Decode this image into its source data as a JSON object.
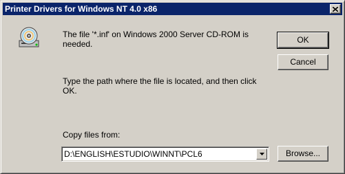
{
  "window": {
    "title": "Printer Drivers for Windows NT 4.0 x86"
  },
  "message": {
    "line1": "The file '*.inf' on Windows 2000 Server CD-ROM is needed.",
    "line2": "Type the path where the file is located, and then click OK."
  },
  "buttons": {
    "ok": "OK",
    "cancel": "Cancel",
    "browse": "Browse..."
  },
  "copy_from": {
    "label": "Copy files from:",
    "value": "D:\\ENGLISH\\ESTUDIO\\WINNT\\PCL6"
  },
  "icons": {
    "close": "close-icon",
    "cd": "cd-rom-icon",
    "dropdown": "chevron-down-icon"
  },
  "colors": {
    "titlebar": "#0a246a",
    "dialog_bg": "#d4d0c8"
  }
}
